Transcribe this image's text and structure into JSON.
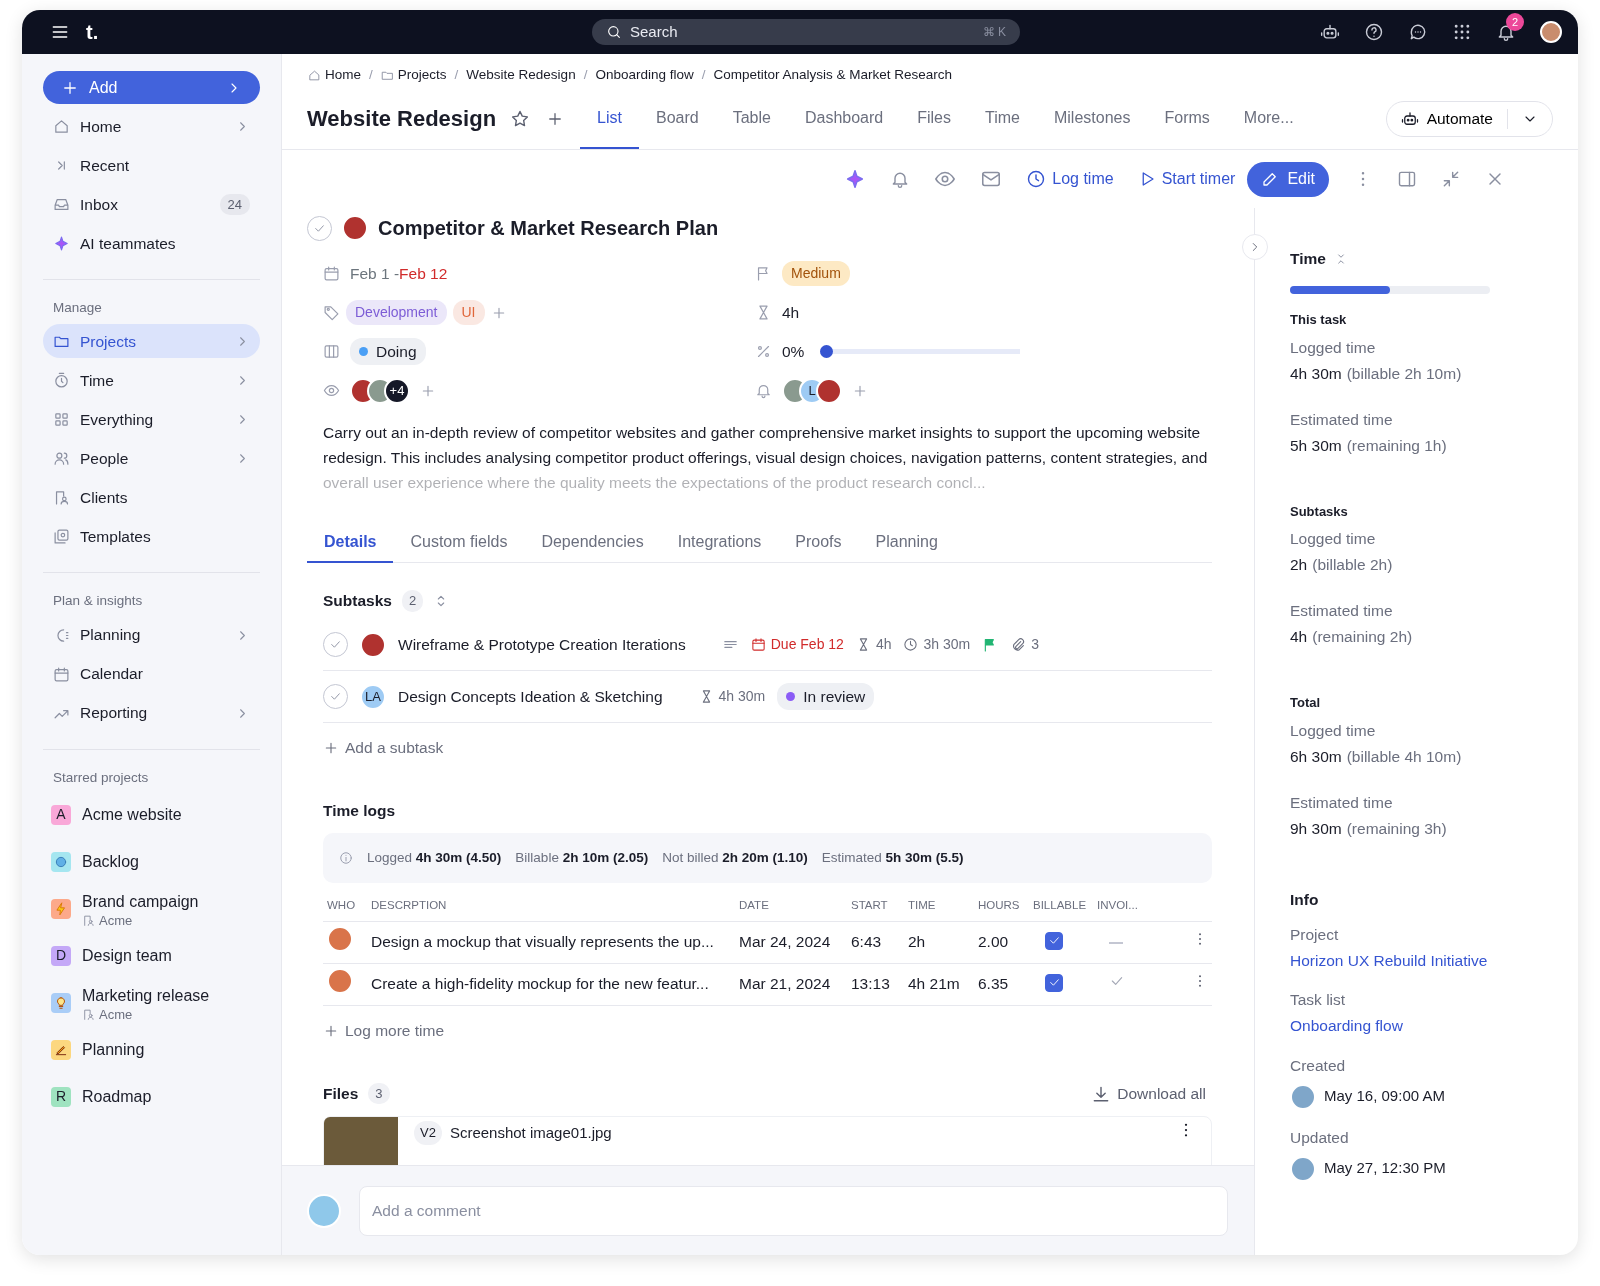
{
  "topbar": {
    "logo": "t.",
    "search_placeholder": "Search",
    "shortcut": "⌘ K",
    "notifications": "2"
  },
  "sidebar": {
    "add_label": "Add",
    "groups": [
      {
        "items": [
          {
            "label": "Home",
            "chevron": true,
            "selected": false
          },
          {
            "label": "Recent",
            "chevron": false,
            "selected": false
          },
          {
            "label": "Inbox",
            "chevron": false,
            "selected": false,
            "count": "24"
          },
          {
            "label": "AI teammates",
            "chevron": false,
            "selected": false
          }
        ]
      },
      {
        "title": "Manage",
        "items": [
          {
            "label": "Projects",
            "chevron": true,
            "selected": true
          },
          {
            "label": "Time",
            "chevron": true,
            "selected": false
          },
          {
            "label": "Everything",
            "chevron": true,
            "selected": false
          },
          {
            "label": "People",
            "chevron": true,
            "selected": false
          },
          {
            "label": "Clients",
            "chevron": false,
            "selected": false
          },
          {
            "label": "Templates",
            "chevron": false,
            "selected": false
          }
        ]
      },
      {
        "title": "Plan & insights",
        "items": [
          {
            "label": "Planning",
            "chevron": true,
            "selected": false
          },
          {
            "label": "Calendar",
            "chevron": false,
            "selected": false
          },
          {
            "label": "Reporting",
            "chevron": true,
            "selected": false
          }
        ]
      }
    ],
    "starred": {
      "title": "Starred projects",
      "items": [
        {
          "label": "Acme website",
          "letter": "A",
          "color": "#f9a8d8"
        },
        {
          "label": "Backlog",
          "color": "#a5e6f0"
        },
        {
          "label": "Brand campaign",
          "color": "#fca98a",
          "client": "Acme"
        },
        {
          "label": "Design team",
          "letter": "D",
          "color": "#c4a8f7"
        },
        {
          "label": "Marketing release",
          "color": "#a9cdf7",
          "client": "Acme"
        },
        {
          "label": "Planning",
          "color": "#fcd77f"
        },
        {
          "label": "Roadmap",
          "letter": "R",
          "color": "#9fe3c0"
        }
      ]
    }
  },
  "breadcrumbs": [
    {
      "label": "Home"
    },
    {
      "separator": "/",
      "label": "Projects"
    },
    {
      "separator": "/",
      "label": "Website Redesign"
    },
    {
      "separator": "/",
      "label": "Onboarding flow"
    },
    {
      "separator": "/",
      "label": "Competitor Analysis & Market Research"
    }
  ],
  "project": {
    "title": "Website Redesign",
    "tabs": [
      {
        "label": "List",
        "selected": true
      },
      {
        "label": "Board",
        "selected": false
      },
      {
        "label": "Table",
        "selected": false
      },
      {
        "label": "Dashboard",
        "selected": false
      },
      {
        "label": "Files",
        "selected": false
      },
      {
        "label": "Time",
        "selected": false
      },
      {
        "label": "Milestones",
        "selected": false
      },
      {
        "label": "Forms",
        "selected": false
      },
      {
        "label": "More...",
        "selected": false
      }
    ],
    "automate": "Automate"
  },
  "toolbar": {
    "log_time": "Log time",
    "start_timer": "Start timer",
    "edit": "Edit"
  },
  "task": {
    "title": "Competitor & Market Research Plan",
    "completed": false,
    "date_start": "Feb 1",
    "date_separator": " - ",
    "date_end": "Feb 12",
    "date_overdue": true,
    "priority": "Medium",
    "tags": [
      {
        "label": "Development",
        "color": "#7c5cd6"
      },
      {
        "label": "UI",
        "color": "#e0663a"
      }
    ],
    "estimate": "4h",
    "status": {
      "label": "Doing",
      "color": "#4a9ff5"
    },
    "progress": {
      "reading": "0%",
      "level": 0
    },
    "watchers_more": "+4",
    "follower_initial": "L",
    "description": "Carry out an in-depth review of competitor websites and gather comprehensive market insights to support the upcoming website redesign. This includes analysing competitor product offerings, visual design choices, navigation patterns, content strategies, and overall user experience where the quality meets the expectations of the product research concl..."
  },
  "detail_tabs": [
    {
      "label": "Details",
      "selected": true
    },
    {
      "label": "Custom fields",
      "selected": false
    },
    {
      "label": "Dependencies",
      "selected": false
    },
    {
      "label": "Integrations",
      "selected": false
    },
    {
      "label": "Proofs",
      "selected": false
    },
    {
      "label": "Planning",
      "selected": false
    }
  ],
  "subtasks": {
    "title": "Subtasks",
    "count": "2",
    "add_label": "Add a subtask",
    "items": [
      {
        "title": "Wireframe & Prototype Creation Iterations",
        "completed": false,
        "has_description": true,
        "due": "Due Feb 12",
        "due_overdue": true,
        "estimate": "4h",
        "logged": "3h 30m",
        "flagged": true,
        "attachments": "3"
      },
      {
        "title": "Design Concepts Ideation & Sketching",
        "completed": false,
        "has_description": false,
        "flagged": false,
        "initials": "LA",
        "estimate": "4h 30m",
        "status": {
          "label": "In review",
          "color": "#8b5cf6"
        }
      }
    ]
  },
  "time_logs": {
    "title": "Time logs",
    "summary": [
      {
        "label": "Logged",
        "value": "4h 30m (4.50)"
      },
      {
        "label": "Billable",
        "value": "2h 10m (2.05)"
      },
      {
        "label": "Not billed",
        "value": "2h 20m (1.10)"
      },
      {
        "label": "Estimated",
        "value": "5h 30m (5.5)"
      }
    ],
    "columns": [
      "WHO",
      "DESCRPTION",
      "DATE",
      "START",
      "TIME",
      "HOURS",
      "BILLABLE",
      "INVOI..."
    ],
    "rows": [
      {
        "description": "Design a mockup that visually represents the up...",
        "date": "Mar 24, 2024",
        "start": "6:43",
        "time": "2h",
        "hours": "2.00",
        "billable": true,
        "invoiced": false
      },
      {
        "description": "Create a high-fidelity mockup for the new featur...",
        "date": "Mar 21, 2024",
        "start": "13:13",
        "time": "4h 21m",
        "hours": "6.35",
        "billable": true,
        "invoiced": true
      }
    ],
    "add_label": "Log more time"
  },
  "files": {
    "title": "Files",
    "count": "3",
    "download_label": "Download all",
    "items": [
      {
        "version": "V2",
        "name": "Screenshot image01.jpg"
      }
    ]
  },
  "comment": {
    "placeholder": "Add a comment"
  },
  "panel": {
    "time_title": "Time",
    "level": 0.5,
    "sections": [
      {
        "title": "This task",
        "rows": [
          {
            "label": "Logged time",
            "value": "4h 30m",
            "note": "(billable 2h 10m)"
          },
          {
            "label": "Estimated time",
            "value": "5h 30m",
            "note": "(remaining 1h)"
          }
        ]
      },
      {
        "title": "Subtasks",
        "rows": [
          {
            "label": "Logged time",
            "value": "2h",
            "note": "(billable 2h)"
          },
          {
            "label": "Estimated time",
            "value": "4h",
            "note": "(remaining 2h)"
          }
        ]
      },
      {
        "title": "Total",
        "rows": [
          {
            "label": "Logged time",
            "value": "6h 30m",
            "note": "(billable 4h 10m)"
          },
          {
            "label": "Estimated time",
            "value": "9h 30m",
            "note": "(remaining 3h)"
          }
        ]
      }
    ],
    "info_title": "Info",
    "info": [
      {
        "kind": "link",
        "label": "Project",
        "value": "Horizon UX Rebuild Initiative"
      },
      {
        "kind": "link",
        "label": "Task list",
        "value": "Onboarding flow"
      },
      {
        "kind": "person",
        "label": "Created",
        "value": "May 16, 09:00 AM"
      },
      {
        "kind": "person",
        "label": "Updated",
        "value": "May 27, 12:30 PM"
      }
    ]
  }
}
